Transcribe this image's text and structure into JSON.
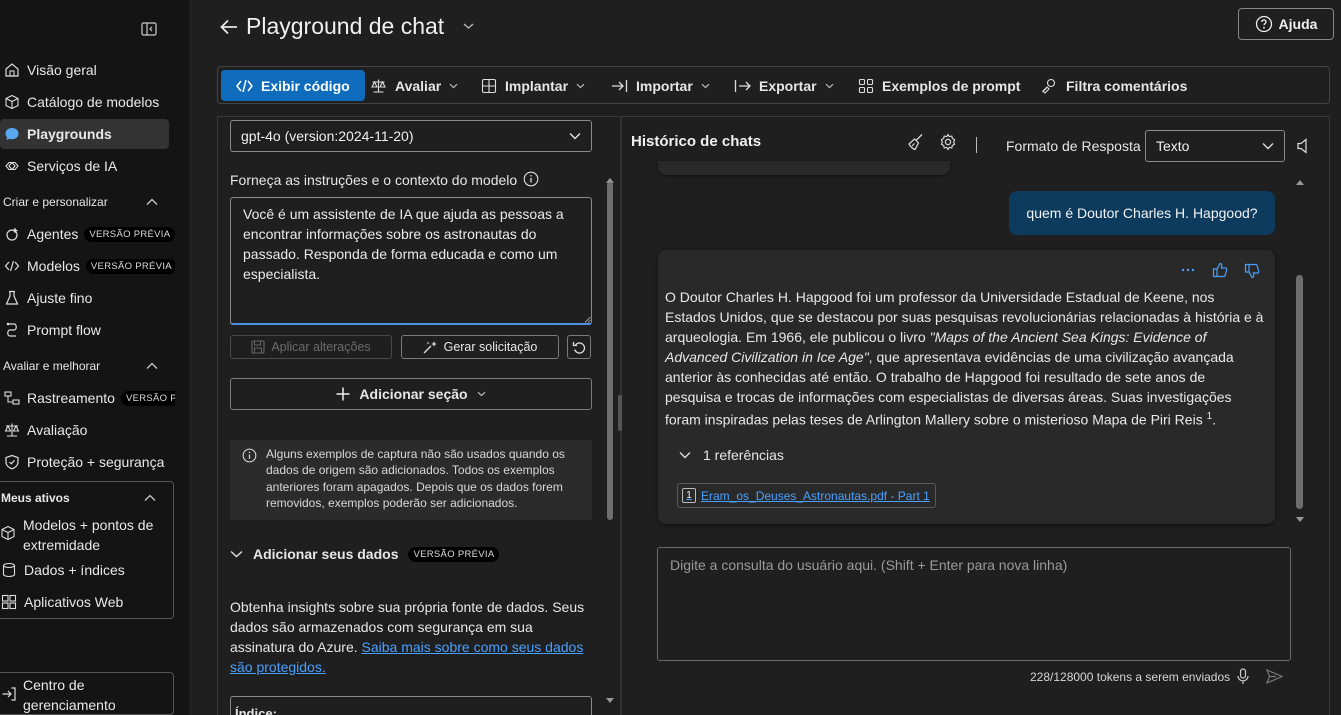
{
  "sidebar": {
    "items_top": [
      {
        "label": "Visão geral",
        "icon": "home-icon"
      },
      {
        "label": "Catálogo de modelos",
        "icon": "cube-icon"
      },
      {
        "label": "Playgrounds",
        "icon": "chat-icon",
        "active": true
      },
      {
        "label": "Serviços de IA",
        "icon": "link-icon"
      }
    ],
    "section_create": "Criar e personalizar",
    "items_create": [
      {
        "label": "Agentes",
        "badge": "VERSÃO PRÉVIA"
      },
      {
        "label": "Modelos",
        "badge": "VERSÃO PRÉVIA"
      },
      {
        "label": "Ajuste fino"
      },
      {
        "label": "Prompt flow"
      }
    ],
    "section_evaluate": "Avaliar e melhorar",
    "items_evaluate": [
      {
        "label": "Rastreamento",
        "badge": "VERSÃO PRÉ"
      },
      {
        "label": "Avaliação"
      },
      {
        "label": "Proteção + segurança"
      }
    ],
    "section_assets": "Meus ativos",
    "items_assets": [
      {
        "label_line1": "Modelos + pontos de",
        "label_line2": "extremidade"
      },
      {
        "label": "Dados + índices"
      },
      {
        "label": "Aplicativos Web"
      }
    ],
    "mgmt_line1": "Centro de",
    "mgmt_line2": "gerenciamento"
  },
  "header": {
    "title": "Playground de chat",
    "help": "Ajuda"
  },
  "toolbar": {
    "view_code": "Exibir código",
    "evaluate": "Avaliar",
    "deploy": "Implantar",
    "import": "Importar",
    "export": "Exportar",
    "prompt_examples": "Exemplos de prompt",
    "filter_comments": "Filtra comentários"
  },
  "setup": {
    "deployment": "gpt-4o (version:2024-11-20)",
    "instructions_label": "Forneça as instruções e o contexto do modelo",
    "system_message": "Você é um assistente de IA que ajuda as pessoas a encontrar informações sobre os astronautas do passado. Responda de forma educada e como um especialista.",
    "apply_changes": "Aplicar alterações",
    "generate_prompt": "Gerar solicitação",
    "add_section": "Adicionar seção",
    "info_text": "Alguns exemplos de captura não são usados quando os dados de origem são adicionados. Todos os exemplos anteriores foram apagados. Depois que os dados forem removidos, exemplos poderão ser adicionados.",
    "add_data_title": "Adicionar seus dados",
    "add_data_badge": "VERSÃO PRÉVIA",
    "add_data_desc": "Obtenha insights sobre sua própria fonte de dados. Seus dados são armazenados com segurança em sua assinatura do Azure.",
    "add_data_link": "Saiba mais sobre como seus dados são protegidos.",
    "index_label": "Índice:"
  },
  "chat": {
    "title": "Histórico de chats",
    "response_format_label": "Formato de Resposta",
    "response_format_value": "Texto",
    "user_message": "quem é  Doutor Charles H. Hapgood?",
    "assistant_part1": "O Doutor Charles H. Hapgood foi um professor da Universidade Estadual de Keene, nos Estados Unidos, que se destacou por suas pesquisas revolucionárias relacionadas à história e à arqueologia. Em 1966, ele publicou o livro ",
    "assistant_book": "\"Maps of the Ancient Sea Kings: Evidence of Advanced Civilization in Ice Age\"",
    "assistant_part2": ", que apresentava evidências de uma civilização avançada anterior às conhecidas até então. O trabalho de Hapgood foi resultado de sete anos de pesquisa e trocas de informações com especialistas de diversas áreas. Suas investigações foram inspiradas pelas teses de Arlington Mallery sobre o misterioso Mapa de Piri Reis ",
    "assistant_sup": "1",
    "assistant_end": ".",
    "references_label": "1 referências",
    "ref_num": "1",
    "ref_name": "Eram_os_Deuses_Astronautas.pdf - Part 1",
    "query_placeholder": "Digite a consulta do usuário aqui. (Shift + Enter para nova linha)",
    "token_count": "228/128000 tokens a serem enviados"
  },
  "colors": {
    "accent": "#0f6cbd",
    "user_bubble": "#0c3b5e",
    "link": "#4aa0ff"
  }
}
